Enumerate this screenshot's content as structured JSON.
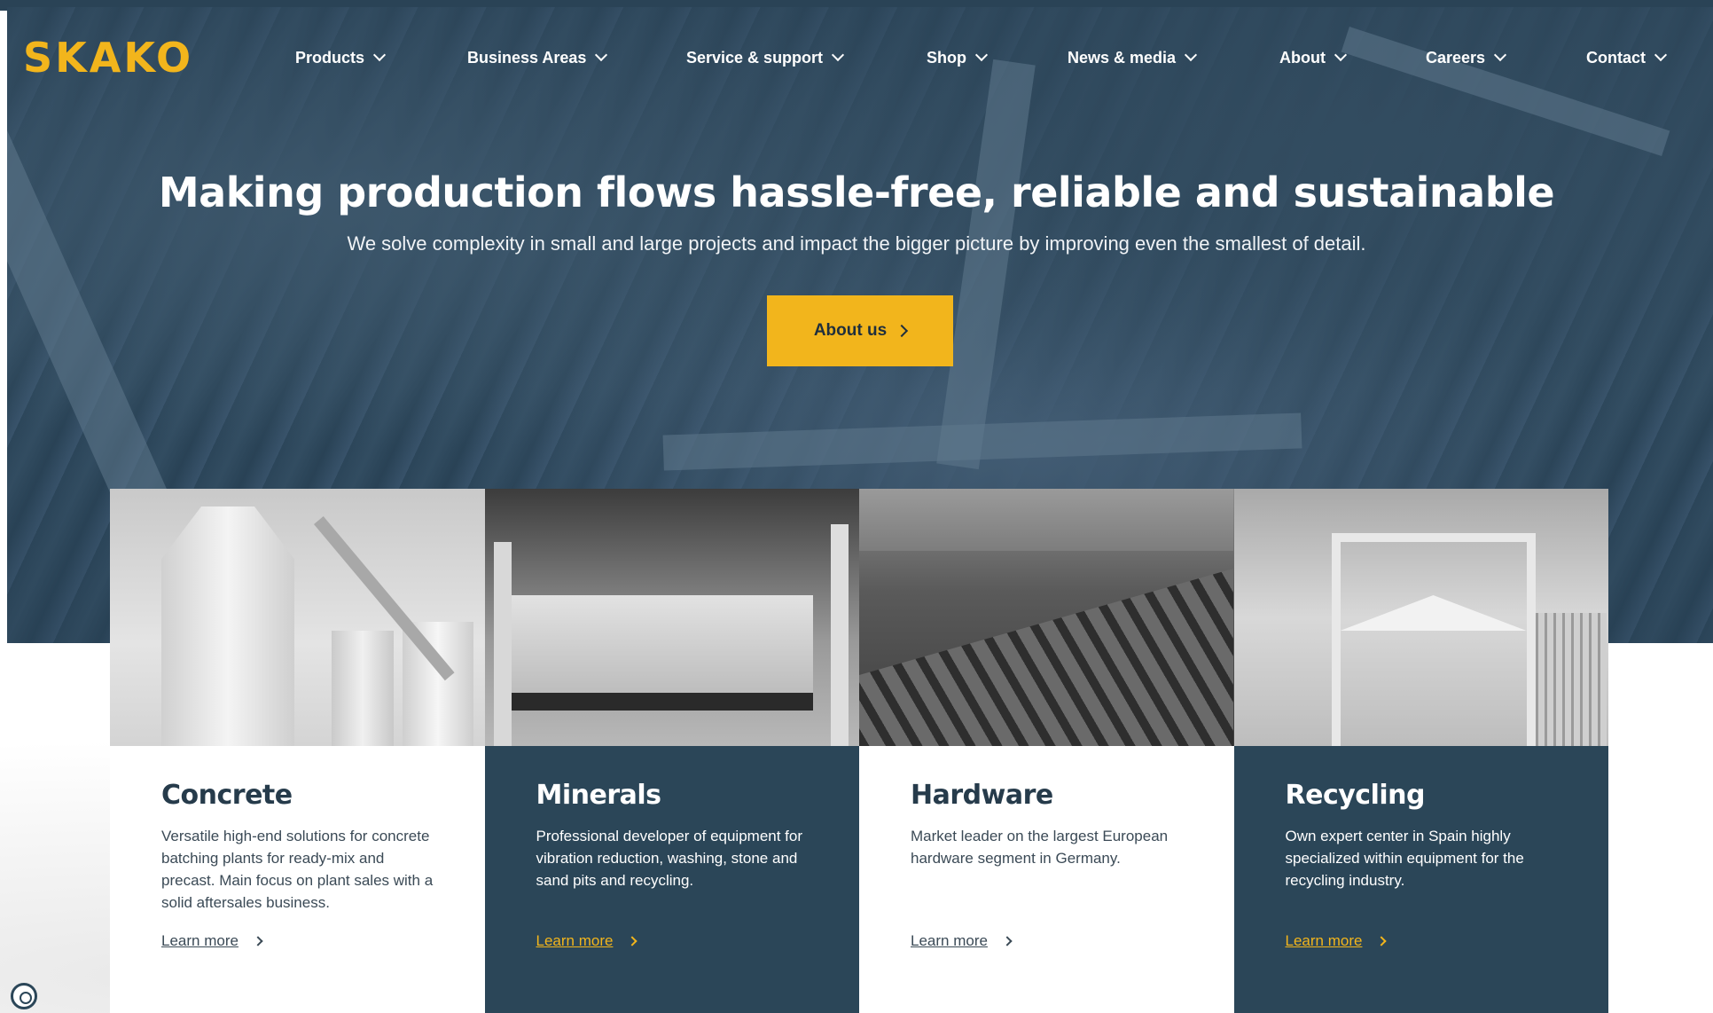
{
  "brand": {
    "logo": "SKAKO",
    "accent": "#f2b51c",
    "navy": "#2b4658"
  },
  "nav": [
    {
      "label": "Products"
    },
    {
      "label": "Business Areas"
    },
    {
      "label": "Service & support"
    },
    {
      "label": "Shop"
    },
    {
      "label": "News & media"
    },
    {
      "label": "About"
    },
    {
      "label": "Careers"
    },
    {
      "label": "Contact"
    }
  ],
  "hero": {
    "title": "Making production flows hassle-free, reliable and sustainable",
    "subtitle": "We solve complexity in small and large projects and impact the bigger picture by improving even the smallest of detail.",
    "cta": "About us"
  },
  "cards": [
    {
      "title": "Concrete",
      "description": "Versatile high-end solutions for concrete batching plants for ready-mix and precast. Main focus on plant sales with a solid aftersales business.",
      "link": "Learn more",
      "theme": "light"
    },
    {
      "title": "Minerals",
      "description": "Professional developer of equipment for vibration reduction, washing, stone and sand pits and recycling.",
      "link": "Learn more",
      "theme": "dark"
    },
    {
      "title": "Hardware",
      "description": "Market leader on the largest European hardware segment in Germany.",
      "link": "Learn more",
      "theme": "light"
    },
    {
      "title": "Recycling",
      "description": "Own expert center in Spain highly specialized within equipment for the recycling industry.",
      "link": "Learn more",
      "theme": "dark"
    }
  ],
  "icons": {
    "chevron": "chevron-down-icon",
    "arrow": "chevron-right-icon",
    "cookie": "cookie-settings-icon"
  }
}
